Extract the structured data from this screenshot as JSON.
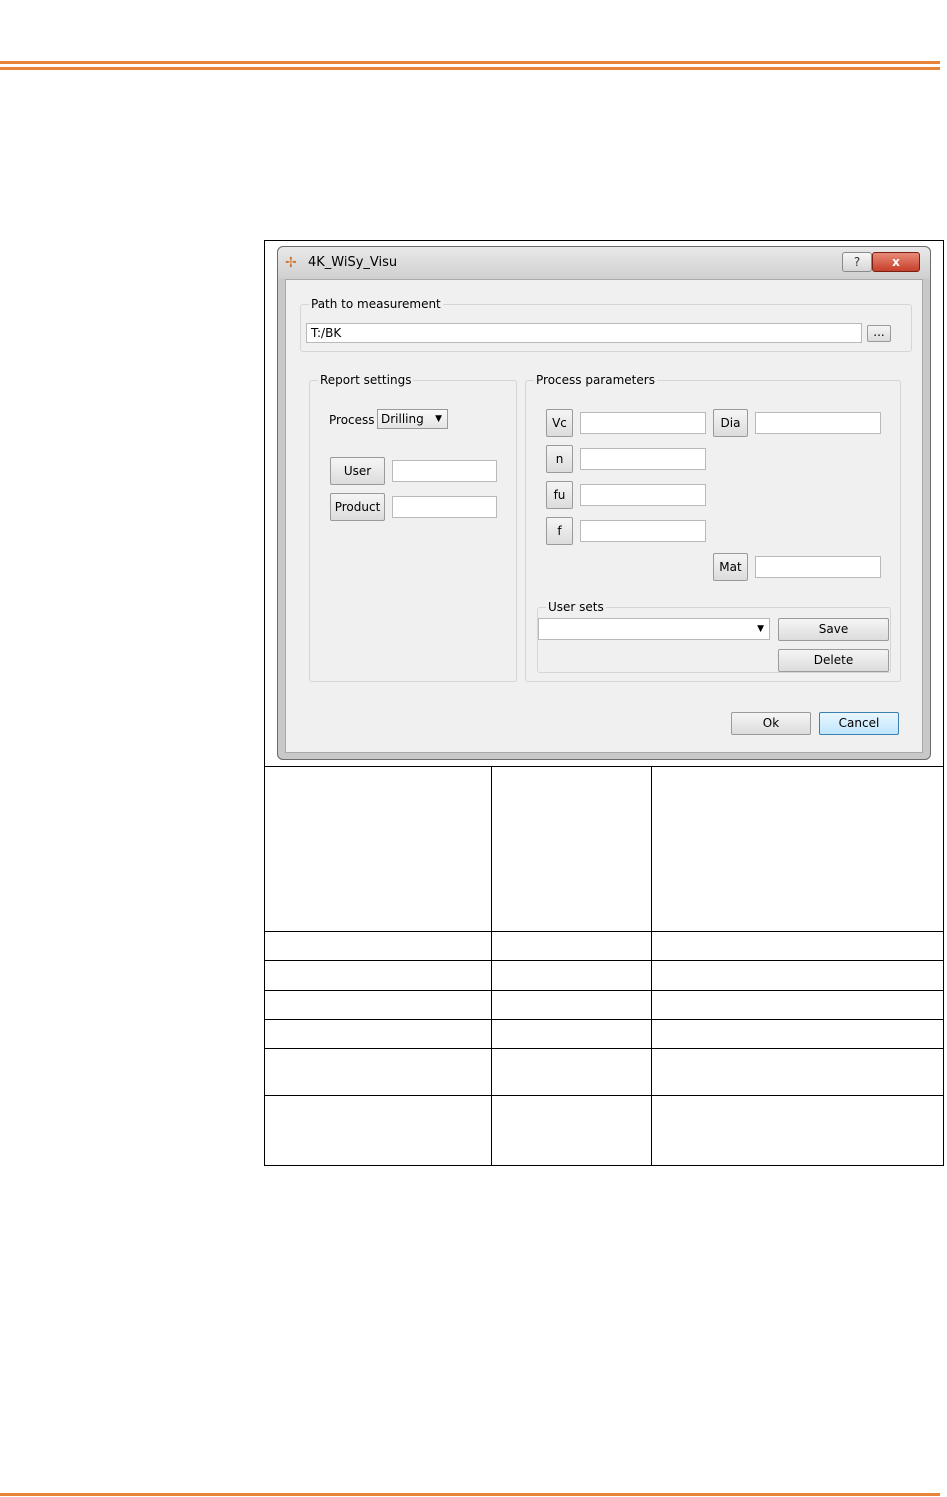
{
  "dialog": {
    "title": "4K_WiSy_Visu",
    "help_label": "?",
    "close_label": "x",
    "path_group": {
      "title": "Path to measurement",
      "path_value": "T:/BK",
      "browse_label": "..."
    },
    "report_settings": {
      "title": "Report settings",
      "process_label": "Process",
      "process_value": "Drilling",
      "user_label": "User",
      "user_value": "",
      "product_label": "Product",
      "product_value": ""
    },
    "process_parameters": {
      "title": "Process parameters",
      "vc_label": "Vc",
      "dia_label": "Dia",
      "n_label": "n",
      "fu_label": "fu",
      "f_label": "f",
      "mat_label": "Mat",
      "vc_value": "",
      "dia_value": "",
      "n_value": "",
      "fu_value": "",
      "f_value": "",
      "mat_value": ""
    },
    "user_sets": {
      "title": "User sets",
      "selected": "",
      "save_label": "Save",
      "delete_label": "Delete"
    },
    "ok_label": "Ok",
    "cancel_label": "Cancel"
  },
  "colors": {
    "accent_rule": "#e8843a",
    "close_button": "#c6402a",
    "dialog_bg": "#f0f0f0"
  },
  "icons": [
    "app-logo-icon",
    "help-icon",
    "close-icon",
    "dropdown-arrow-icon"
  ]
}
